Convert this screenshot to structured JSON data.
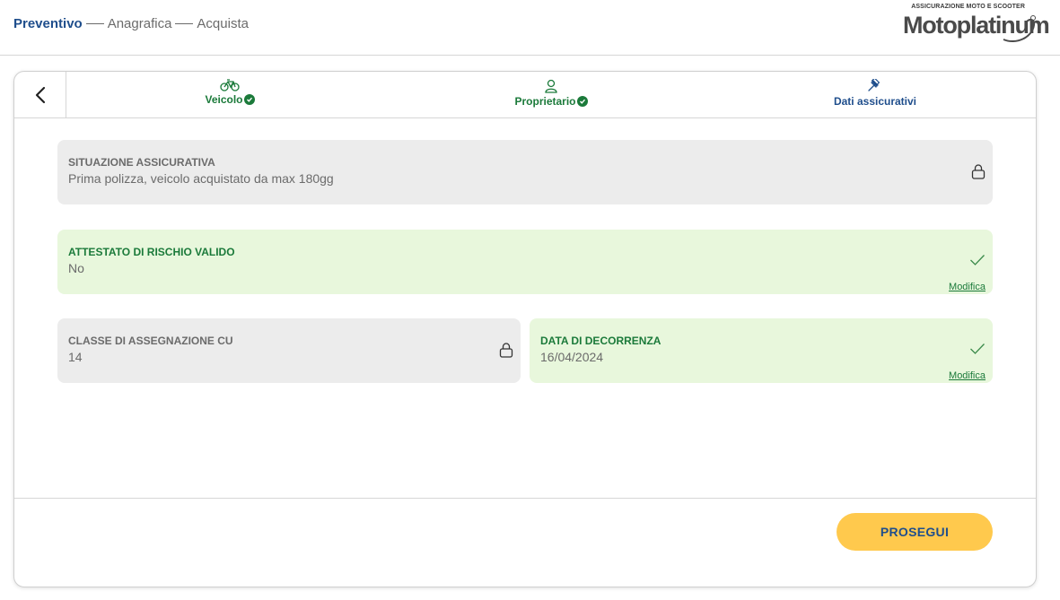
{
  "breadcrumb": {
    "step1": "Preventivo",
    "step2": "Anagrafica",
    "step3": "Acquista"
  },
  "logo": {
    "tagline": "ASSICURAZIONE MOTO E SCOOTER",
    "name": "Motoplatinum"
  },
  "tabs": [
    {
      "label": "Veicolo",
      "icon": "bicycle-icon",
      "completed": true
    },
    {
      "label": "Proprietario",
      "icon": "person-icon",
      "completed": true
    },
    {
      "label": "Dati assicurativi",
      "icon": "gavel-icon",
      "completed": false
    }
  ],
  "fields": {
    "situazione": {
      "label": "SITUAZIONE ASSICURATIVA",
      "value": "Prima polizza, veicolo acquistato da max 180gg",
      "state": "locked"
    },
    "attestato": {
      "label": "ATTESTATO DI RISCHIO VALIDO",
      "value": "No",
      "state": "ok",
      "action": "Modifica"
    },
    "classe": {
      "label": "CLASSE DI ASSEGNAZIONE CU",
      "value": "14",
      "state": "locked"
    },
    "decorrenza": {
      "label": "DATA DI DECORRENZA",
      "value": "16/04/2024",
      "state": "ok",
      "action": "Modifica"
    }
  },
  "actions": {
    "prosegui": "PROSEGUI"
  },
  "colors": {
    "brand_blue": "#1f4e8c",
    "success_green": "#1b7a3a",
    "ok_bg": "#e8f7dc",
    "locked_bg": "#ececec",
    "cta_yellow": "#ffc94d"
  }
}
